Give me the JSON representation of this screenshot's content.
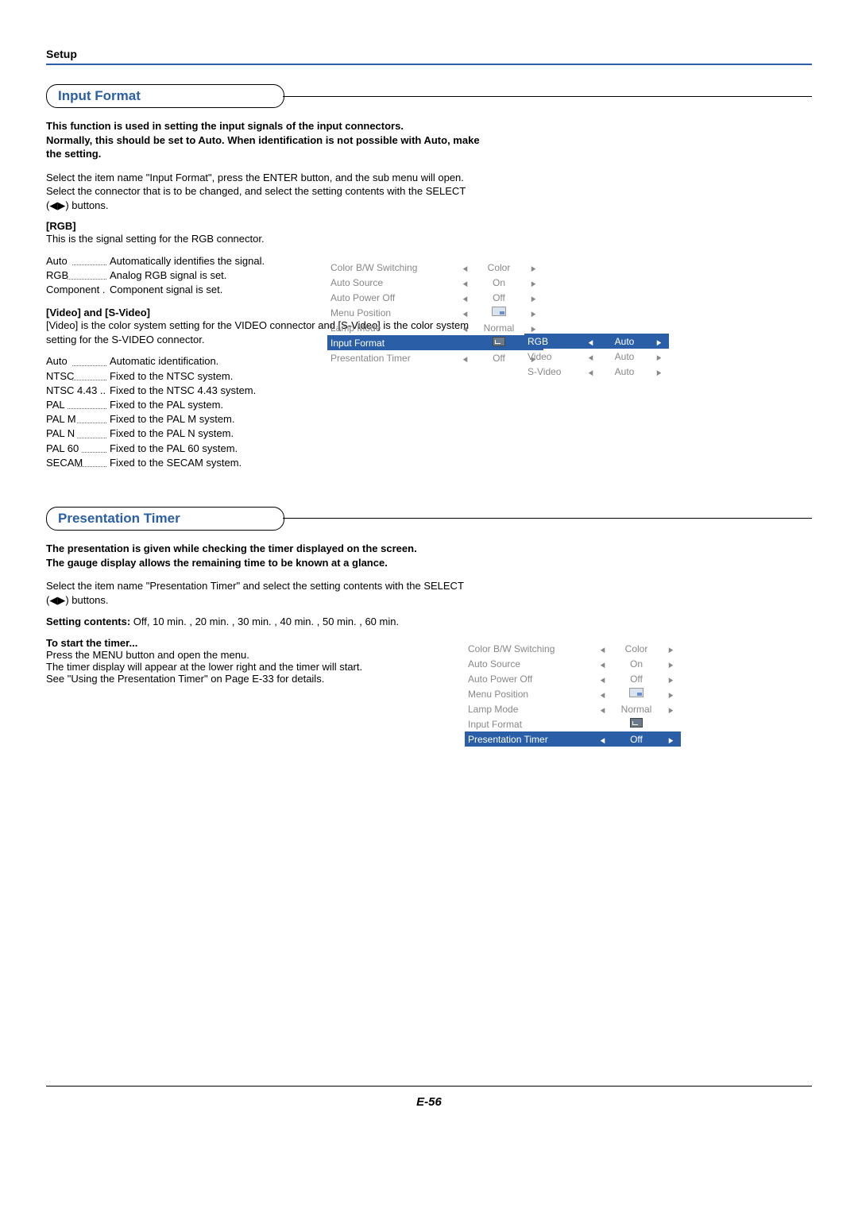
{
  "page": {
    "setup": "Setup",
    "footer": "E-56"
  },
  "sec1": {
    "heading": "Input Format",
    "intro1": "This function is used in setting the input signals of the input connectors.",
    "intro2": "Normally, this should be set to Auto. When identification is not possible with Auto, make the setting.",
    "instr1": "Select the item name \"Input Format\", press the ENTER button, and the sub menu will open.",
    "instr2": "Select the connector that is to be changed, and select the setting contents with the SELECT (◀▶) buttons.",
    "rgb_head": "[RGB]",
    "rgb_desc": "This is the signal setting for the RGB connector.",
    "rgb_defs": [
      {
        "k": "Auto",
        "v": "Automatically identifies the signal."
      },
      {
        "k": "RGB",
        "v": "Analog RGB signal is set."
      },
      {
        "k": "Component .",
        "v": "Component signal is set.",
        "noline": true
      }
    ],
    "vid_head": "[Video] and [S-Video]",
    "vid_desc": "[Video] is the color system setting for the VIDEO connector and [S-Video] is the color system setting for the S-VIDEO connector.",
    "vid_defs": [
      {
        "k": "Auto",
        "v": "Automatic identification."
      },
      {
        "k": "NTSC",
        "v": "Fixed to the NTSC system."
      },
      {
        "k": "NTSC 4.43 ..",
        "v": "Fixed to the NTSC 4.43 system.",
        "noline": true
      },
      {
        "k": "PAL",
        "v": "Fixed to the PAL system."
      },
      {
        "k": "PAL M",
        "v": "Fixed to the PAL M system."
      },
      {
        "k": "PAL N",
        "v": "Fixed to the PAL N system."
      },
      {
        "k": "PAL 60",
        "v": "Fixed to the PAL 60 system."
      },
      {
        "k": "SECAM",
        "v": "Fixed to the SECAM system."
      }
    ]
  },
  "sec2": {
    "heading": "Presentation Timer",
    "intro1": "The presentation is given while checking the timer displayed on the screen.",
    "intro2": "The gauge display allows the remaining time to be known at a glance.",
    "instr1": "Select the item name \"Presentation Timer\" and select the setting contents with the SELECT (◀▶) buttons.",
    "setting_label": "Setting contents:",
    "setting_values": " Off, 10 min. , 20 min. , 30 min. , 40 min. , 50 min. , 60 min.",
    "start_head": "To start the timer...",
    "start_l1": "Press the MENU button and open the menu.",
    "start_l2": "The timer display will appear at the lower right and the timer will start.",
    "start_l3": "See \"Using the Presentation Timer\" on Page E-33 for details."
  },
  "osd_main": {
    "rows": [
      {
        "label": "Color B/W Switching",
        "val": "Color",
        "type": "lr"
      },
      {
        "label": "Auto Source",
        "val": "On",
        "type": "lr"
      },
      {
        "label": "Auto Power Off",
        "val": "Off",
        "type": "lr"
      },
      {
        "label": "Menu Position",
        "val": "",
        "type": "lr-icon"
      },
      {
        "label": "Lamp Mode",
        "val": "Normal",
        "type": "lr"
      },
      {
        "label": "Input Format",
        "val": "",
        "type": "enter",
        "hl": true
      },
      {
        "label": "Presentation Timer",
        "val": "Off",
        "type": "lr"
      }
    ]
  },
  "osd_sub": {
    "rows": [
      {
        "label": "RGB",
        "val": "Auto",
        "hl": true
      },
      {
        "label": "Video",
        "val": "Auto"
      },
      {
        "label": "S-Video",
        "val": "Auto"
      }
    ]
  },
  "osd_timer": {
    "rows": [
      {
        "label": "Color B/W Switching",
        "val": "Color",
        "type": "lr"
      },
      {
        "label": "Auto Source",
        "val": "On",
        "type": "lr"
      },
      {
        "label": "Auto Power Off",
        "val": "Off",
        "type": "lr"
      },
      {
        "label": "Menu Position",
        "val": "",
        "type": "lr-icon"
      },
      {
        "label": "Lamp Mode",
        "val": "Normal",
        "type": "lr"
      },
      {
        "label": "Input Format",
        "val": "",
        "type": "enter"
      },
      {
        "label": "Presentation Timer",
        "val": "Off",
        "type": "lr",
        "hl": true
      }
    ]
  }
}
